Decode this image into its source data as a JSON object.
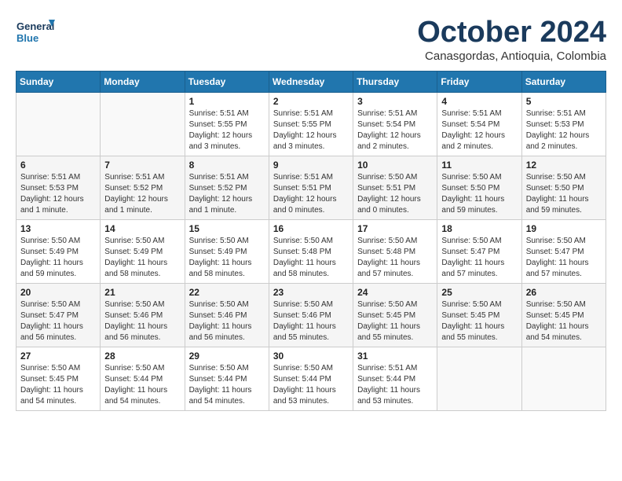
{
  "header": {
    "logo_line1": "General",
    "logo_line2": "Blue",
    "month_title": "October 2024",
    "subtitle": "Canasgordas, Antioquia, Colombia"
  },
  "days_of_week": [
    "Sunday",
    "Monday",
    "Tuesday",
    "Wednesday",
    "Thursday",
    "Friday",
    "Saturday"
  ],
  "weeks": [
    [
      {
        "day": "",
        "info": ""
      },
      {
        "day": "",
        "info": ""
      },
      {
        "day": "1",
        "info": "Sunrise: 5:51 AM\nSunset: 5:55 PM\nDaylight: 12 hours and 3 minutes."
      },
      {
        "day": "2",
        "info": "Sunrise: 5:51 AM\nSunset: 5:55 PM\nDaylight: 12 hours and 3 minutes."
      },
      {
        "day": "3",
        "info": "Sunrise: 5:51 AM\nSunset: 5:54 PM\nDaylight: 12 hours and 2 minutes."
      },
      {
        "day": "4",
        "info": "Sunrise: 5:51 AM\nSunset: 5:54 PM\nDaylight: 12 hours and 2 minutes."
      },
      {
        "day": "5",
        "info": "Sunrise: 5:51 AM\nSunset: 5:53 PM\nDaylight: 12 hours and 2 minutes."
      }
    ],
    [
      {
        "day": "6",
        "info": "Sunrise: 5:51 AM\nSunset: 5:53 PM\nDaylight: 12 hours and 1 minute."
      },
      {
        "day": "7",
        "info": "Sunrise: 5:51 AM\nSunset: 5:52 PM\nDaylight: 12 hours and 1 minute."
      },
      {
        "day": "8",
        "info": "Sunrise: 5:51 AM\nSunset: 5:52 PM\nDaylight: 12 hours and 1 minute."
      },
      {
        "day": "9",
        "info": "Sunrise: 5:51 AM\nSunset: 5:51 PM\nDaylight: 12 hours and 0 minutes."
      },
      {
        "day": "10",
        "info": "Sunrise: 5:50 AM\nSunset: 5:51 PM\nDaylight: 12 hours and 0 minutes."
      },
      {
        "day": "11",
        "info": "Sunrise: 5:50 AM\nSunset: 5:50 PM\nDaylight: 11 hours and 59 minutes."
      },
      {
        "day": "12",
        "info": "Sunrise: 5:50 AM\nSunset: 5:50 PM\nDaylight: 11 hours and 59 minutes."
      }
    ],
    [
      {
        "day": "13",
        "info": "Sunrise: 5:50 AM\nSunset: 5:49 PM\nDaylight: 11 hours and 59 minutes."
      },
      {
        "day": "14",
        "info": "Sunrise: 5:50 AM\nSunset: 5:49 PM\nDaylight: 11 hours and 58 minutes."
      },
      {
        "day": "15",
        "info": "Sunrise: 5:50 AM\nSunset: 5:49 PM\nDaylight: 11 hours and 58 minutes."
      },
      {
        "day": "16",
        "info": "Sunrise: 5:50 AM\nSunset: 5:48 PM\nDaylight: 11 hours and 58 minutes."
      },
      {
        "day": "17",
        "info": "Sunrise: 5:50 AM\nSunset: 5:48 PM\nDaylight: 11 hours and 57 minutes."
      },
      {
        "day": "18",
        "info": "Sunrise: 5:50 AM\nSunset: 5:47 PM\nDaylight: 11 hours and 57 minutes."
      },
      {
        "day": "19",
        "info": "Sunrise: 5:50 AM\nSunset: 5:47 PM\nDaylight: 11 hours and 57 minutes."
      }
    ],
    [
      {
        "day": "20",
        "info": "Sunrise: 5:50 AM\nSunset: 5:47 PM\nDaylight: 11 hours and 56 minutes."
      },
      {
        "day": "21",
        "info": "Sunrise: 5:50 AM\nSunset: 5:46 PM\nDaylight: 11 hours and 56 minutes."
      },
      {
        "day": "22",
        "info": "Sunrise: 5:50 AM\nSunset: 5:46 PM\nDaylight: 11 hours and 56 minutes."
      },
      {
        "day": "23",
        "info": "Sunrise: 5:50 AM\nSunset: 5:46 PM\nDaylight: 11 hours and 55 minutes."
      },
      {
        "day": "24",
        "info": "Sunrise: 5:50 AM\nSunset: 5:45 PM\nDaylight: 11 hours and 55 minutes."
      },
      {
        "day": "25",
        "info": "Sunrise: 5:50 AM\nSunset: 5:45 PM\nDaylight: 11 hours and 55 minutes."
      },
      {
        "day": "26",
        "info": "Sunrise: 5:50 AM\nSunset: 5:45 PM\nDaylight: 11 hours and 54 minutes."
      }
    ],
    [
      {
        "day": "27",
        "info": "Sunrise: 5:50 AM\nSunset: 5:45 PM\nDaylight: 11 hours and 54 minutes."
      },
      {
        "day": "28",
        "info": "Sunrise: 5:50 AM\nSunset: 5:44 PM\nDaylight: 11 hours and 54 minutes."
      },
      {
        "day": "29",
        "info": "Sunrise: 5:50 AM\nSunset: 5:44 PM\nDaylight: 11 hours and 54 minutes."
      },
      {
        "day": "30",
        "info": "Sunrise: 5:50 AM\nSunset: 5:44 PM\nDaylight: 11 hours and 53 minutes."
      },
      {
        "day": "31",
        "info": "Sunrise: 5:51 AM\nSunset: 5:44 PM\nDaylight: 11 hours and 53 minutes."
      },
      {
        "day": "",
        "info": ""
      },
      {
        "day": "",
        "info": ""
      }
    ]
  ]
}
